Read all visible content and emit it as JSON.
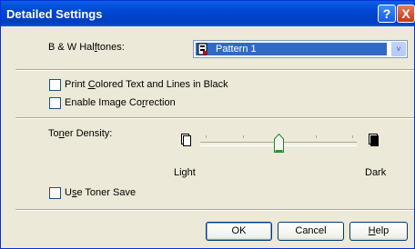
{
  "title_bar": {
    "title": "Detailed Settings",
    "help_glyph": "?",
    "close_glyph": "X"
  },
  "halftones": {
    "label_pre": "B & W Hal",
    "label_u": "f",
    "label_post": "tones:",
    "selected": "Pattern 1",
    "arrow_glyph": "˅"
  },
  "checks": {
    "print_black": {
      "pre": "Print ",
      "u": "C",
      "post": "olored Text and Lines in Black",
      "checked": false
    },
    "image_correction": {
      "pre": "Enable Image Co",
      "u": "r",
      "post": "rection",
      "checked": false
    },
    "toner_save": {
      "pre": "U",
      "u": "s",
      "post": "e Toner Save",
      "checked": false
    }
  },
  "toner_density": {
    "label_pre": "To",
    "label_u": "n",
    "label_post": "er Density:",
    "light_label": "Light",
    "dark_label": "Dark",
    "level_fraction": 0.5
  },
  "buttons": {
    "ok": "OK",
    "cancel": "Cancel",
    "help_pre": "",
    "help_u": "H",
    "help_post": "elp"
  },
  "icons": {
    "combo": "pattern-page-icon",
    "light": "light-page-icon",
    "dark": "dark-page-icon",
    "thumb": "slider-thumb"
  },
  "colors": {
    "titlebar": "#0054e3",
    "selection": "#316ac5",
    "dialog_bg": "#ece9d8"
  }
}
